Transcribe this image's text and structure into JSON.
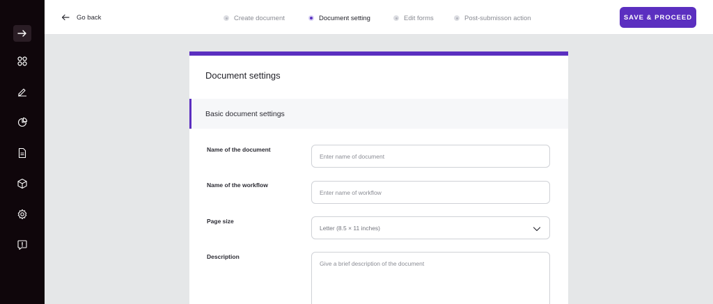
{
  "sidebar": {
    "icons": [
      "arrow-right-icon",
      "grid-icon",
      "pen-icon",
      "pie-chart-icon",
      "document-icon",
      "cube-icon",
      "gear-icon",
      "feedback-icon"
    ]
  },
  "header": {
    "go_back": "Go back",
    "steps": [
      {
        "label": "Create document",
        "state": "inactive"
      },
      {
        "label": "Document setting",
        "state": "active"
      },
      {
        "label": "Edit forms",
        "state": "inactive"
      },
      {
        "label": "Post-submisson action",
        "state": "inactive"
      }
    ],
    "save_button": "SAVE & PROCEED"
  },
  "card": {
    "title": "Document settings",
    "section_title": "Basic document settings",
    "fields": {
      "document_name": {
        "label": "Name of the document",
        "placeholder": "Enter name of document",
        "value": ""
      },
      "workflow_name": {
        "label": "Name of the workflow",
        "placeholder": "Enter name of workflow",
        "value": ""
      },
      "page_size": {
        "label": "Page size",
        "value": "Letter (8.5 × 11 inches)"
      },
      "description": {
        "label": "Description",
        "placeholder": "Give a brief description of the document",
        "value": ""
      }
    }
  },
  "colors": {
    "accent": "#5b2fc0",
    "sidebar_bg": "#0f060b",
    "page_bg": "#e5e7e8"
  }
}
